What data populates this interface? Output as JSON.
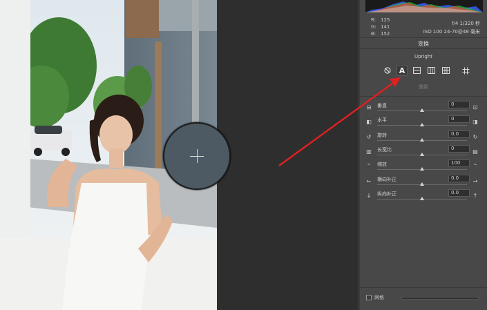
{
  "histogram": {
    "colors": [
      "#ff2020",
      "#20c020",
      "#2040ff",
      "#ffff30",
      "#30ffff",
      "#ff30ff"
    ]
  },
  "readout": {
    "r_label": "R:",
    "r_value": "125",
    "g_label": "G:",
    "g_value": "141",
    "b_label": "B:",
    "b_value": "152"
  },
  "camera": {
    "line1": "f/4  1/320 秒",
    "line2": "ISO 100  24-70@48 毫米"
  },
  "transform": {
    "title": "变换",
    "upright_label": "Upright",
    "reanalyze": "重新",
    "accent": "#e02020"
  },
  "sliders": [
    {
      "label": "垂直",
      "value": "0",
      "level": 0.5,
      "icon_left": "⊟",
      "icon_right": "⊡"
    },
    {
      "label": "水平",
      "value": "0",
      "level": 0.5,
      "icon_left": "◧",
      "icon_right": "◨"
    },
    {
      "label": "旋转",
      "value": "0.0",
      "level": 0.5,
      "icon_left": "↺",
      "icon_right": "↻"
    },
    {
      "label": "长宽比",
      "value": "0",
      "level": 0.5,
      "icon_left": "▥",
      "icon_right": "▤"
    },
    {
      "label": "缩放",
      "value": "100",
      "level": 0.5,
      "icon_left": "⌃",
      "icon_right": "⌃"
    },
    {
      "label": "横向补正",
      "value": "0.0",
      "level": 0.5,
      "icon_left": "←",
      "icon_right": "→"
    },
    {
      "label": "纵向补正",
      "value": "0.0",
      "level": 0.5,
      "icon_left": "↓",
      "icon_right": "↑"
    }
  ],
  "grid": {
    "label": "网格"
  }
}
